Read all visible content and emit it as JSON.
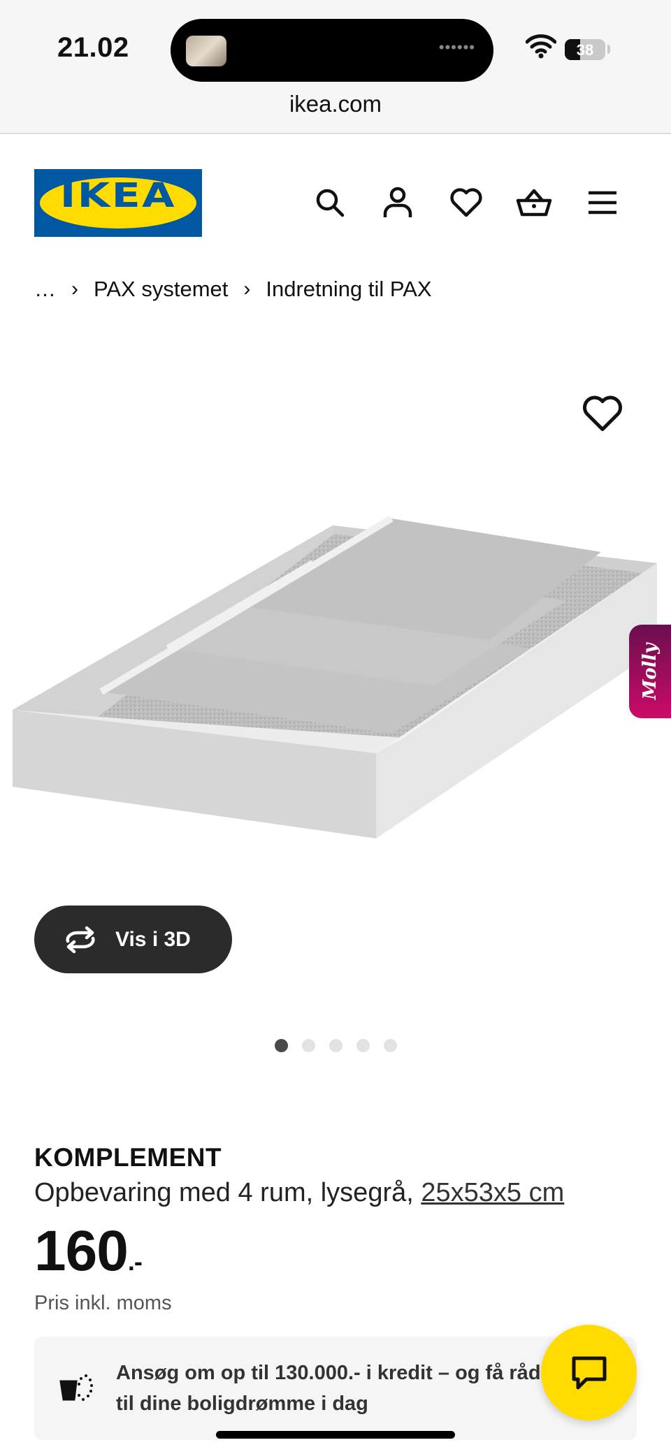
{
  "status_bar": {
    "time": "21.02",
    "battery": "38",
    "battery_level": 0.38,
    "island_dots": "••••••"
  },
  "browser": {
    "url": "ikea.com"
  },
  "header": {
    "logo_text": "IKEA",
    "logo_registered": "®",
    "icons": [
      "search-icon",
      "account-icon",
      "heart-icon",
      "basket-icon",
      "menu-icon"
    ]
  },
  "breadcrumb": {
    "items": [
      "…",
      "PAX systemet",
      "Indretning til PAX"
    ],
    "separator": "›"
  },
  "product": {
    "gallery": {
      "button_3d": "Vis i 3D",
      "image_count": 5,
      "active_index": 0
    },
    "name": "KOMPLEMENT",
    "description": "Opbevaring med 4 rum, lysegrå, ",
    "size_link": "25x53x5 cm",
    "price": "160",
    "price_suffix": ".-",
    "price_note": "Pris inkl. moms"
  },
  "molly": {
    "label": "Molly"
  },
  "credit_banner": {
    "text": "Ansøg om op til 130.000.- i kredit – og få råd til dine boligdrømme i dag"
  },
  "colors": {
    "ikea_blue": "#0058a3",
    "ikea_yellow": "#ffdb00",
    "dark_button": "#2b2b2b",
    "molly_gradient_start": "#6a0f4e",
    "molly_gradient_end": "#cc0a67"
  }
}
